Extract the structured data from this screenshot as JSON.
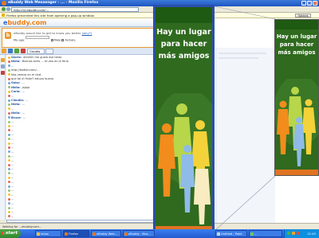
{
  "window": {
    "title": "eBuddy Web Messenger - ... - Mozilla Firefox"
  },
  "browser": {
    "url": "http://nl.ebuddy.com/...",
    "infobar_text": "Firefox prevented this site from opening a pop-up window.",
    "options_label": "Options"
  },
  "ebuddy": {
    "logo_prefix": "e",
    "logo_rest": "buddy.com",
    "notice": {
      "message": "eBuddy would like to get to know you better",
      "link": "(why?)",
      "row_label": "My age:",
      "option1": "Male",
      "option2": "Female"
    },
    "chat_tab_label": "Claudia",
    "chat_lines": [
      {
        "nick": "Gloria:",
        "text": "ahhhhh me gusta ese texto"
      },
      {
        "nick": "Nidia:",
        "text": "Buenos Aires ... te veo en la feria"
      },
      {
        "nick": "",
        "text": "..."
      },
      {
        "nick": "",
        "text": "http://twitter.com/..."
      },
      {
        "nick": "",
        "text": "Nos vemos en el chat"
      },
      {
        "nick": "",
        "text": "que tal el finde? estuvo bueno"
      },
      {
        "nick": "Gaby:",
        "text": "..."
      },
      {
        "nick": "Nidia:",
        "text": "jajaja"
      },
      {
        "nick": "Carla:",
        "text": "..."
      },
      {
        "nick": "",
        "text": "..."
      },
      {
        "nick": "Claudia:",
        "text": "..."
      },
      {
        "nick": "Nidia:",
        "text": "..."
      },
      {
        "nick": "",
        "text": "..."
      },
      {
        "nick": "Nidia:",
        "text": "..."
      },
      {
        "nick": "Bruce:",
        "text": "..."
      },
      {
        "nick": "",
        "text": "..."
      },
      {
        "nick": "",
        "text": "..."
      },
      {
        "nick": "",
        "text": "..."
      },
      {
        "nick": "",
        "text": "..."
      },
      {
        "nick": "",
        "text": "..."
      },
      {
        "nick": "",
        "text": "..."
      },
      {
        "nick": "",
        "text": "..."
      },
      {
        "nick": "",
        "text": "..."
      },
      {
        "nick": "",
        "text": "..."
      },
      {
        "nick": "",
        "text": "..."
      },
      {
        "nick": "",
        "text": "..."
      },
      {
        "nick": "",
        "text": "..."
      },
      {
        "nick": "",
        "text": "..."
      },
      {
        "nick": "",
        "text": "..."
      },
      {
        "nick": "",
        "text": "..."
      },
      {
        "nick": "",
        "text": "..."
      },
      {
        "nick": "",
        "text": "..."
      },
      {
        "nick": "",
        "text": "..."
      },
      {
        "nick": "",
        "text": "..."
      },
      {
        "nick": "",
        "text": "..."
      },
      {
        "nick": "",
        "text": "..."
      },
      {
        "nick": "",
        "text": "..."
      },
      {
        "nick": "",
        "text": "..."
      }
    ]
  },
  "ad": {
    "line1": "Hay un lugar",
    "line2": "para hacer",
    "line3": "más amigos",
    "colors": {
      "bg": "#2f6a1e",
      "footer": "#e07421",
      "frame": "#2b4fa8"
    }
  },
  "statusbar": {
    "text": "Waiting for ...ebuddy.com..."
  },
  "taskbar": {
    "start_label": "start",
    "tasks": [
      "Inbox",
      "Firefox",
      "eBuddy Web...",
      "eBuddy - Moz...",
      "Untitled - Paint",
      "..."
    ],
    "clock": "12:45"
  }
}
